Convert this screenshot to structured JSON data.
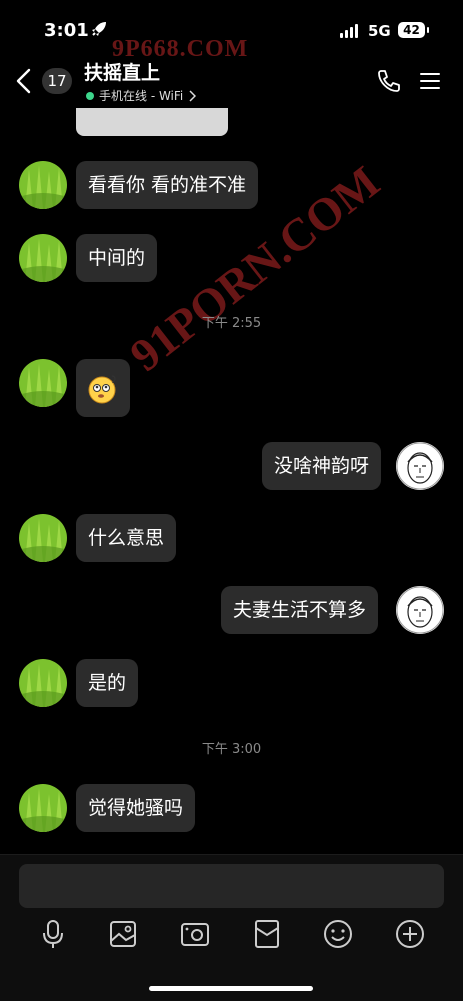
{
  "status_bar": {
    "time": "3:01",
    "network": "5G",
    "battery": "42"
  },
  "header": {
    "unread_count": "17",
    "title": "扶摇直上",
    "online_status": "手机在线 - WiFi",
    "icons": [
      "back-chevron-icon",
      "phone-icon",
      "menu-icon"
    ]
  },
  "watermarks": [
    "9P668.COM",
    "91PORN.COM"
  ],
  "messages": [
    {
      "side": "left",
      "text": "看看你 看的准不准"
    },
    {
      "side": "left",
      "text": "中间的"
    },
    {
      "timestamp": "下午 2:55"
    },
    {
      "side": "left",
      "sticker": "thinking-face-emoji"
    },
    {
      "side": "right",
      "text": "没啥神韵呀"
    },
    {
      "side": "left",
      "text": "什么意思"
    },
    {
      "side": "right",
      "text": "夫妻生活不算多"
    },
    {
      "side": "left",
      "text": "是的"
    },
    {
      "timestamp": "下午 3:00"
    },
    {
      "side": "left",
      "text": "觉得她骚吗"
    }
  ],
  "toolbar": [
    "microphone-icon",
    "image-icon",
    "camera-icon",
    "red-packet-icon",
    "emoji-icon",
    "add-icon"
  ],
  "colors": {
    "background": "#000000",
    "bubble": "#2c2c2c",
    "online": "#3dd68c",
    "timestamp": "#8a8a8a"
  }
}
